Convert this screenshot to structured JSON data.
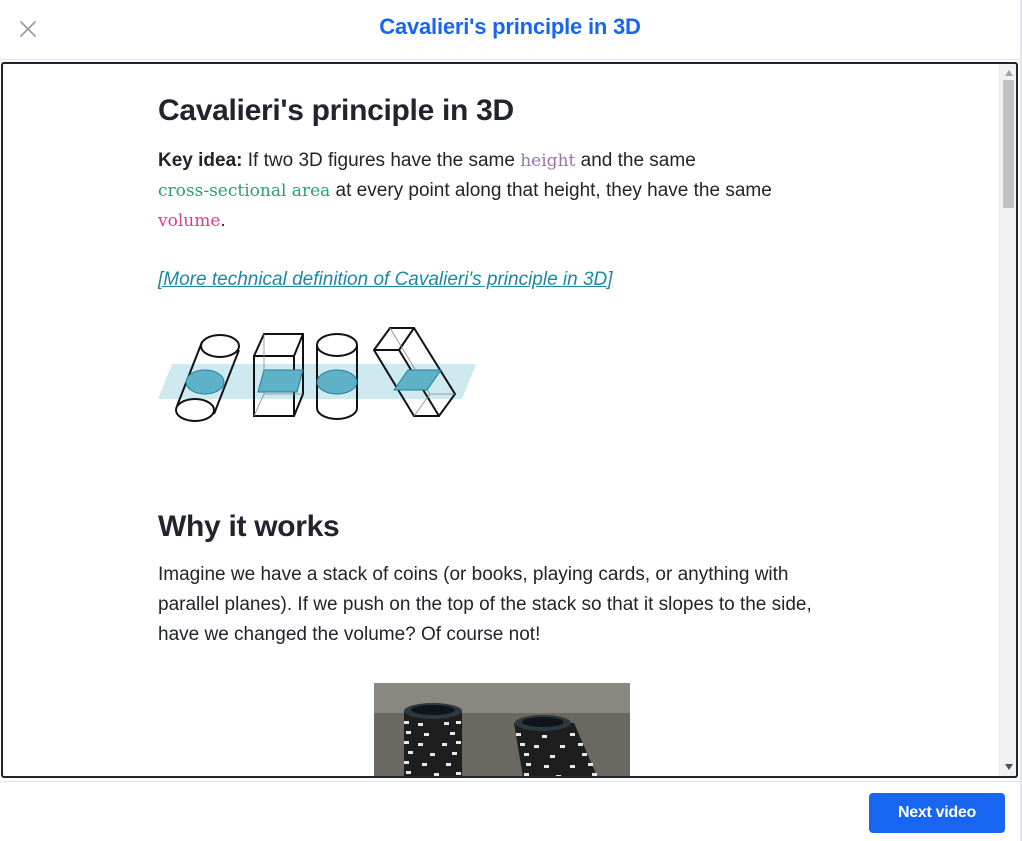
{
  "header": {
    "title": "Cavalieri's principle in 3D",
    "close_icon": "close-icon"
  },
  "article": {
    "title": "Cavalieri's principle in 3D",
    "key_idea_label": "Key idea:",
    "key_idea_text_1": " If two 3D figures have the same ",
    "term_height": "height",
    "key_idea_text_2": " and the same ",
    "term_cross_section": "cross-sectional area",
    "key_idea_text_3": " at every point along that height, they have the same ",
    "term_volume": "volume",
    "key_idea_text_4": ".",
    "technical_link": "[More technical definition of Cavalieri's principle in 3D]",
    "section_title": "Why it works",
    "section_text": "Imagine we have a stack of coins (or books, playing cards, or anything with parallel planes). If we push on the top of the stack so that it slopes to the side, have we changed the volume? Of course not!"
  },
  "footer": {
    "next_label": "Next video"
  },
  "colors": {
    "accent": "#1865f2",
    "height_term": "#9a72ac",
    "cross_section_term": "#28a07a",
    "volume_term": "#d6437f",
    "link": "#1b8aa0"
  }
}
